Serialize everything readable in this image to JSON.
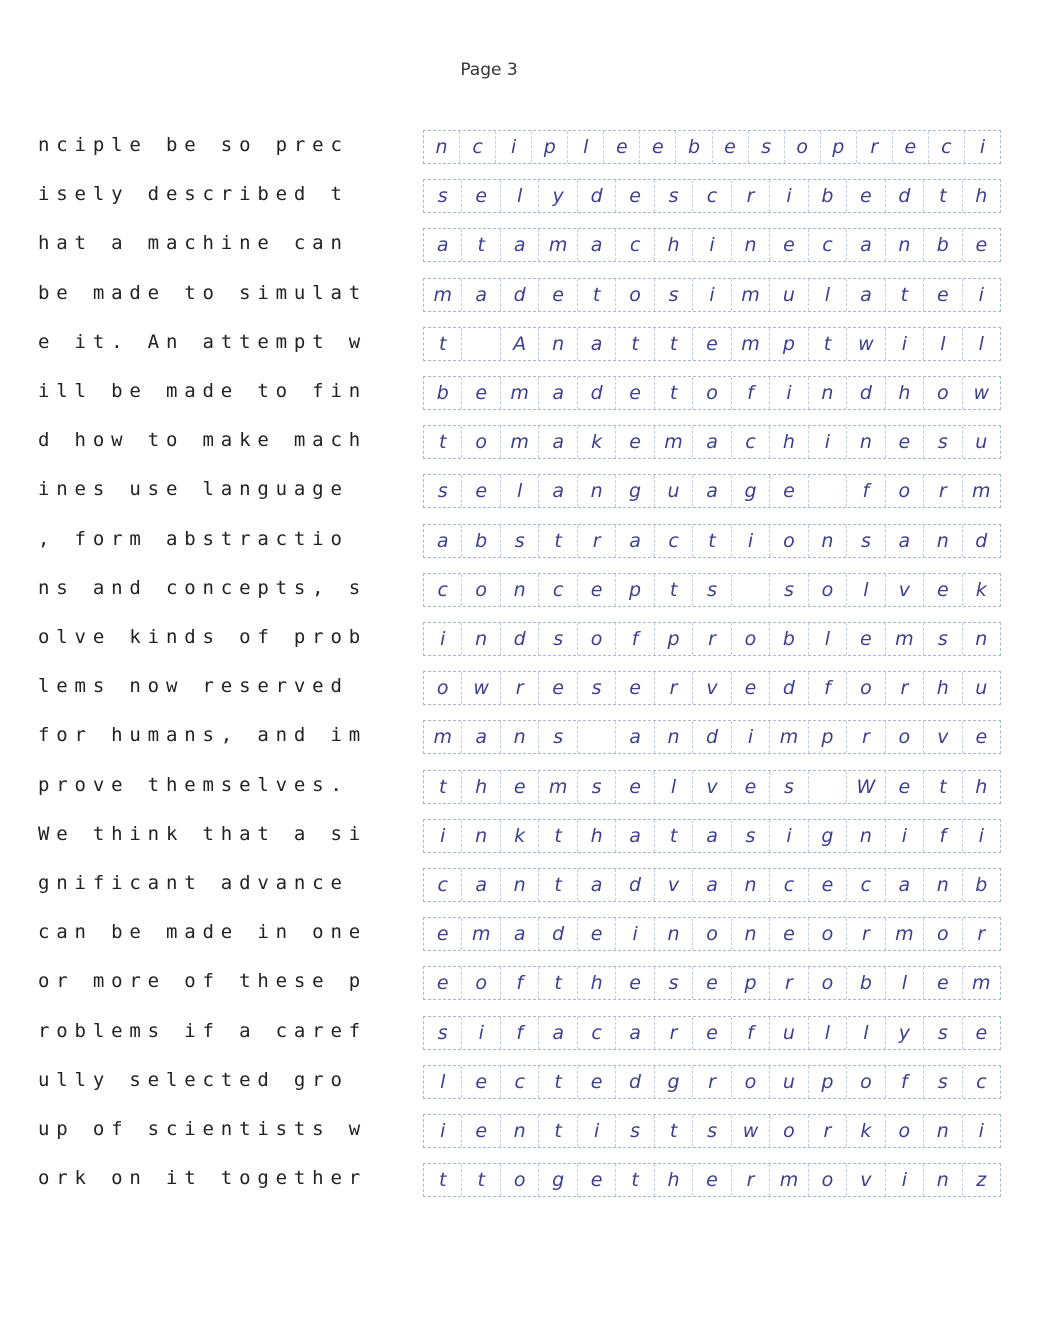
{
  "page_label": "Page 3",
  "rows": [
    {
      "printed": "nciple be so prec",
      "handwritten": "ncipleebesopreci"
    },
    {
      "printed": "isely described t",
      "handwritten": "selydescribedth"
    },
    {
      "printed": "hat a machine can",
      "handwritten": "atamachinecanbe"
    },
    {
      "printed": "be made to simulat",
      "handwritten": "madetosimulatei"
    },
    {
      "printed": "e it. An attempt w",
      "handwritten": "t Anattemptwill"
    },
    {
      "printed": "ill be made to fin",
      "handwritten": "bemadetofindhow"
    },
    {
      "printed": "d how to make mach",
      "handwritten": "tomakemachinesu"
    },
    {
      "printed": "ines use language",
      "handwritten": "selanguage form"
    },
    {
      "printed": ", form abstractio",
      "handwritten": "abstractionsand"
    },
    {
      "printed": "ns and concepts, s",
      "handwritten": "concepts solvek"
    },
    {
      "printed": "olve kinds of prob",
      "handwritten": "indsofproblemsn"
    },
    {
      "printed": "lems now reserved",
      "handwritten": "owreservedforhu"
    },
    {
      "printed": "for humans, and im",
      "handwritten": "mans andimprove"
    },
    {
      "printed": "prove themselves.",
      "handwritten": "themselves Weth"
    },
    {
      "printed": "We think that a si",
      "handwritten": "inkthatasignifi"
    },
    {
      "printed": "gnificant advance",
      "handwritten": "cantadvancecanb"
    },
    {
      "printed": "can be made in one",
      "handwritten": "emadeinoneormor"
    },
    {
      "printed": "or more of these p",
      "handwritten": "eoftheseproblem"
    },
    {
      "printed": "roblems if a caref",
      "handwritten": "sifacarefullyse"
    },
    {
      "printed": "ully selected gro",
      "handwritten": "lectedgroupofsc"
    },
    {
      "printed": "up of scientists w",
      "handwritten": "ientistsworkoni"
    },
    {
      "printed": "ork on it together",
      "handwritten": "ttogethermovinz"
    }
  ]
}
